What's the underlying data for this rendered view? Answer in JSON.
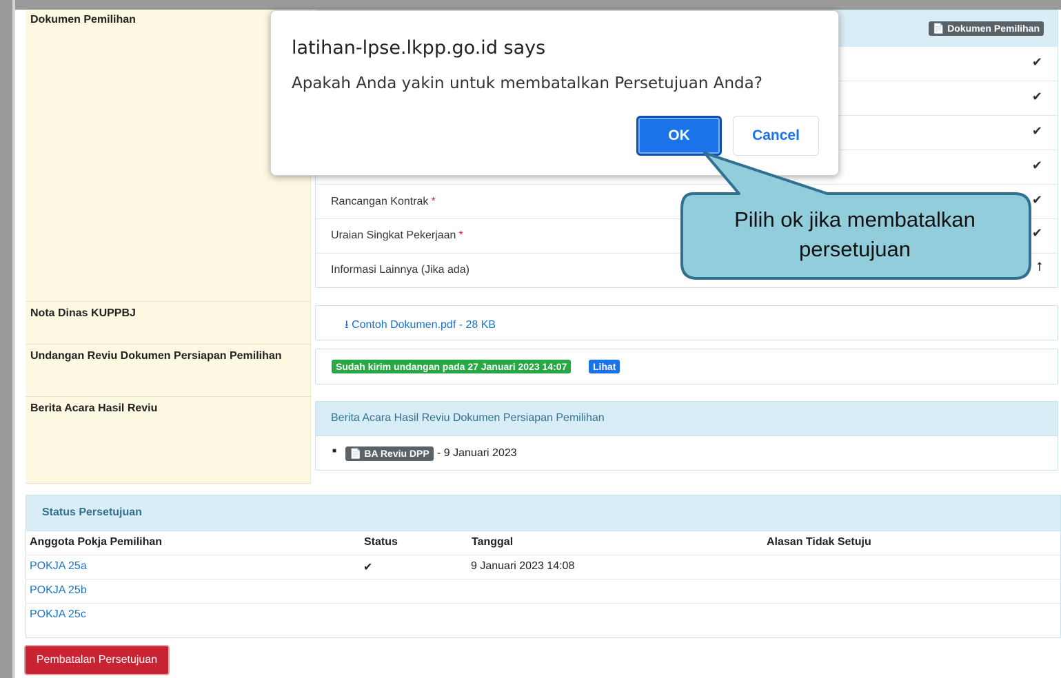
{
  "sections": {
    "dokumen_pemilihan_label": "Dokumen Pemilihan",
    "dokumen_pemilihan_badge": "Dokumen Pemilihan",
    "rows": [
      {
        "label": "Rancangan Kontrak",
        "required": "*",
        "status_icon": "check-icon"
      },
      {
        "label": "Uraian Singkat Pekerjaan",
        "required": "*",
        "status_icon": "check-icon"
      },
      {
        "label": "Informasi Lainnya (Jika ada)",
        "required": "",
        "status_icon": "upload-icon"
      }
    ],
    "nota_dinas_label": "Nota Dinas KUPPBJ",
    "nota_dinas_file": "Contoh Dokumen.pdf - 28 KB",
    "undangan_label": "Undangan Reviu Dokumen Persiapan Pemilihan",
    "undangan_badge": "Sudah kirim undangan pada 27 Januari 2023 14:07",
    "undangan_lihat": "Lihat",
    "berita_acara_label": "Berita Acara Hasil Reviu",
    "berita_acara_head": "Berita Acara Hasil Reviu Dokumen Persiapan Pemilihan",
    "berita_acara_badge": "BA Reviu DPP",
    "berita_acara_date": "- 9 Januari 2023"
  },
  "status_table": {
    "title": "Status Persetujuan",
    "headers": [
      "Anggota Pokja Pemilihan",
      "Status",
      "Tanggal",
      "Alasan Tidak Setuju"
    ],
    "rows": [
      {
        "anggota": "POKJA 25a",
        "status": "✔",
        "tanggal": "9 Januari 2023 14:08",
        "alasan": ""
      },
      {
        "anggota": "POKJA 25b",
        "status": "",
        "tanggal": "",
        "alasan": ""
      },
      {
        "anggota": "POKJA 25c",
        "status": "",
        "tanggal": "",
        "alasan": ""
      }
    ]
  },
  "cancel_approval_button": "Pembatalan Persetujuan",
  "dialog": {
    "title": "latihan-lpse.lkpp.go.id says",
    "message": "Apakah Anda yakin untuk membatalkan Persetujuan Anda?",
    "ok": "OK",
    "cancel": "Cancel"
  },
  "callout": {
    "line1": "Pilih ok jika membatalkan",
    "line2": "persetujuan"
  },
  "colors": {
    "accent_blue": "#1a73e8",
    "danger_red": "#c82333",
    "success_green": "#28a745",
    "label_bg": "#fdf8e1",
    "panel_head_bg": "#d9edf7",
    "callout_fill": "#92cddc",
    "callout_stroke": "#31708f"
  }
}
